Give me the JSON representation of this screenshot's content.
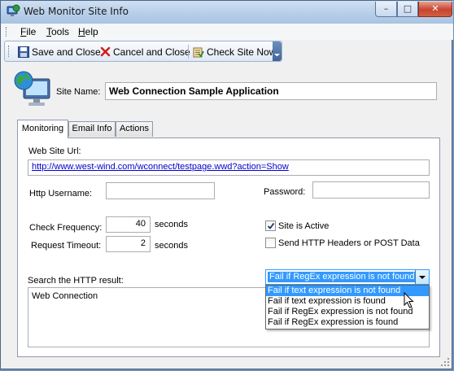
{
  "window": {
    "title": "Web Monitor Site Info",
    "minimize": "–",
    "maximize": "□",
    "close": "✕"
  },
  "menu": {
    "items": [
      {
        "label": "File"
      },
      {
        "label": "Tools"
      },
      {
        "label": "Help"
      }
    ]
  },
  "toolbar": {
    "save_label": "Save and Close",
    "cancel_label": "Cancel and Close",
    "check_label": "Check Site Now",
    "icons": [
      "save-icon",
      "cancel-icon",
      "check-site-icon"
    ]
  },
  "site": {
    "name_label": "Site Name:",
    "name_value": "Web Connection Sample Application"
  },
  "tabs": [
    {
      "label": "Monitoring",
      "active": true
    },
    {
      "label": "Email Info",
      "active": false
    },
    {
      "label": "Actions",
      "active": false
    }
  ],
  "monitoring": {
    "url_label": "Web Site Url:",
    "url_value": "http://www.west-wind.com/wconnect/testpage.wwd?action=Show",
    "username_label": "Http Username:",
    "username_value": "",
    "password_label": "Password:",
    "password_value": "",
    "frequency_label": "Check Frequency:",
    "frequency_value": "40",
    "frequency_unit": "seconds",
    "timeout_label": "Request Timeout:",
    "timeout_value": "2",
    "timeout_unit": "seconds",
    "active_label": "Site is Active",
    "active_checked": true,
    "headers_label": "Send HTTP Headers or POST Data",
    "headers_checked": false,
    "search_label": "Search the HTTP result:",
    "search_text": "Web Connection",
    "search_mode": {
      "selected": "Fail if RegEx expression is not found",
      "options": [
        "Fail if text expression is not found",
        "Fail if text expression is found",
        "Fail if RegEx expression is not found",
        "Fail if RegEx expression is found"
      ],
      "highlighted_index": 0
    }
  },
  "colors": {
    "selection": "#3399ff",
    "link": "#0000cc",
    "titlebar": "#b9d0ea"
  }
}
